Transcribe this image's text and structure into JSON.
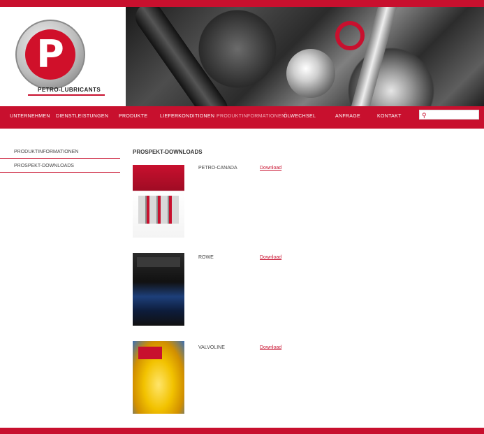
{
  "brand": {
    "logo_text": "PETRO-LUBRICANTS",
    "logo_letter": "P"
  },
  "nav": {
    "items": [
      {
        "label": "UNTERNEHMEN"
      },
      {
        "label": "DIENSTLEISTUNGEN"
      },
      {
        "label": "PRODUKTE"
      },
      {
        "label": "LIEFERKONDITIONEN"
      },
      {
        "label": "PRODUKTINFORMATIONEN"
      },
      {
        "label": "ÖLWECHSEL"
      },
      {
        "label": "ANFRAGE"
      },
      {
        "label": "KONTAKT"
      }
    ]
  },
  "search": {
    "value": "",
    "placeholder": ""
  },
  "sidebar": {
    "items": [
      {
        "label": "PRODUKTINFORMATIONEN"
      },
      {
        "label": "PROSPEKT-DOWNLOADS"
      }
    ]
  },
  "content": {
    "title": "PROSPEKT-DOWNLOADS",
    "products": [
      {
        "name": "PETRO-CANADA",
        "link": "Download"
      },
      {
        "name": "ROWE",
        "link": "Download"
      },
      {
        "name": "VALVOLINE",
        "link": "Download"
      }
    ]
  },
  "colors": {
    "brand_red": "#c8102e",
    "background": "#ffffff"
  },
  "icons": {
    "search": "search-icon"
  }
}
